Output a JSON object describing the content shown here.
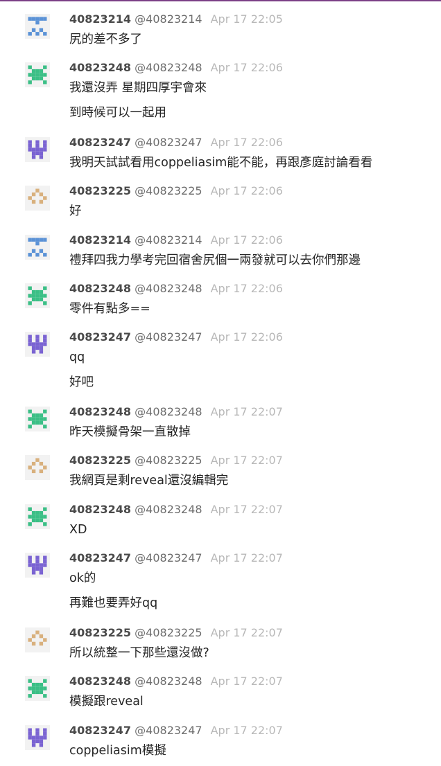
{
  "colors": {
    "blue": "#5b92d6",
    "green": "#3bbf86",
    "purple": "#7a63d2",
    "tan": "#d8b07d"
  },
  "messages": [
    {
      "name": "40823214",
      "handle": "@40823214",
      "time": "Apr 17 22:05",
      "avatar": "blue",
      "lines": [
        "尻的差不多了"
      ]
    },
    {
      "name": "40823248",
      "handle": "@40823248",
      "time": "Apr 17 22:06",
      "avatar": "green",
      "lines": [
        "我還沒弄 星期四厚宇會來",
        "到時候可以一起用"
      ]
    },
    {
      "name": "40823247",
      "handle": "@40823247",
      "time": "Apr 17 22:06",
      "avatar": "purple",
      "lines": [
        "我明天試試看用coppeliasim能不能，再跟彥庭討論看看"
      ]
    },
    {
      "name": "40823225",
      "handle": "@40823225",
      "time": "Apr 17 22:06",
      "avatar": "tan",
      "lines": [
        "好"
      ]
    },
    {
      "name": "40823214",
      "handle": "@40823214",
      "time": "Apr 17 22:06",
      "avatar": "blue",
      "lines": [
        "禮拜四我力學考完回宿舍尻個一兩發就可以去你們那邊"
      ]
    },
    {
      "name": "40823248",
      "handle": "@40823248",
      "time": "Apr 17 22:06",
      "avatar": "green",
      "lines": [
        "零件有點多=="
      ]
    },
    {
      "name": "40823247",
      "handle": "@40823247",
      "time": "Apr 17 22:06",
      "avatar": "purple",
      "lines": [
        "qq",
        "好吧"
      ]
    },
    {
      "name": "40823248",
      "handle": "@40823248",
      "time": "Apr 17 22:07",
      "avatar": "green",
      "lines": [
        "昨天模擬骨架一直散掉"
      ]
    },
    {
      "name": "40823225",
      "handle": "@40823225",
      "time": "Apr 17 22:07",
      "avatar": "tan",
      "lines": [
        "我網頁是剩reveal還沒編輯完"
      ]
    },
    {
      "name": "40823248",
      "handle": "@40823248",
      "time": "Apr 17 22:07",
      "avatar": "green",
      "lines": [
        "XD"
      ]
    },
    {
      "name": "40823247",
      "handle": "@40823247",
      "time": "Apr 17 22:07",
      "avatar": "purple",
      "lines": [
        "ok的",
        "再難也要弄好qq"
      ]
    },
    {
      "name": "40823225",
      "handle": "@40823225",
      "time": "Apr 17 22:07",
      "avatar": "tan",
      "lines": [
        "所以統整一下那些還沒做?"
      ]
    },
    {
      "name": "40823248",
      "handle": "@40823248",
      "time": "Apr 17 22:07",
      "avatar": "green",
      "lines": [
        "模擬跟reveal"
      ]
    },
    {
      "name": "40823247",
      "handle": "@40823247",
      "time": "Apr 17 22:07",
      "avatar": "purple",
      "lines": [
        "coppeliasim模擬"
      ]
    }
  ]
}
